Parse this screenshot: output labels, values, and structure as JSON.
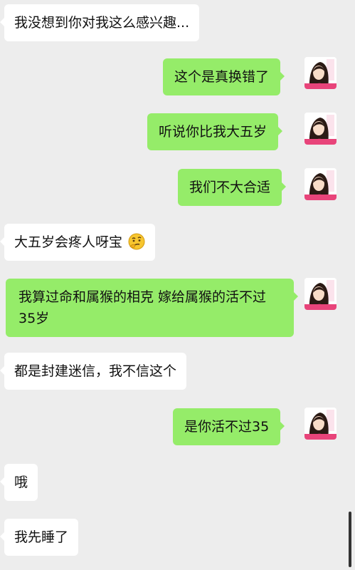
{
  "messages": [
    {
      "side": "in",
      "text": "我没想到你对我这么感兴趣..."
    },
    {
      "side": "out",
      "text": "这个是真换错了"
    },
    {
      "side": "out",
      "text": "听说你比我大五岁"
    },
    {
      "side": "out",
      "text": "我们不大合适"
    },
    {
      "side": "in",
      "text": "大五岁会疼人呀宝",
      "emoji": "thinking-face-icon"
    },
    {
      "side": "out",
      "text": "我算过命和属猴的相克 嫁给属猴的活不过35岁"
    },
    {
      "side": "in",
      "text": "都是封建迷信，我不信这个"
    },
    {
      "side": "out",
      "text": "是你活不过35"
    },
    {
      "side": "in",
      "text": "哦"
    },
    {
      "side": "in",
      "text": "我先睡了"
    }
  ],
  "avatar_icon": "anime-girl-avatar-icon",
  "colors": {
    "background": "#ededed",
    "incoming_bubble": "#ffffff",
    "outgoing_bubble": "#95ec69",
    "avatar_accent": "#e8447a"
  }
}
